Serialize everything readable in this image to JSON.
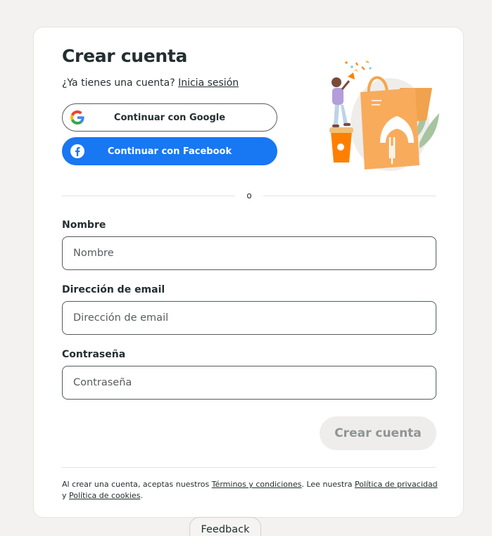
{
  "header": {
    "title": "Crear cuenta",
    "have_account": "¿Ya tienes una cuenta?",
    "login_link": "Inicia sesión"
  },
  "social": {
    "google_label": "Continuar con Google",
    "facebook_label": "Continuar con Facebook"
  },
  "divider": {
    "text": "o"
  },
  "form": {
    "name_label": "Nombre",
    "name_placeholder": "Nombre",
    "email_label": "Dirección de email",
    "email_placeholder": "Dirección de email",
    "password_label": "Contraseña",
    "password_placeholder": "Contraseña",
    "submit_label": "Crear cuenta"
  },
  "legal": {
    "part1": "Al crear una cuenta, aceptas nuestros ",
    "terms": "Términos y condiciones",
    "part2": ". Lee nuestra ",
    "privacy": "Política de privacidad",
    "part3": " y ",
    "cookies": "Política de cookies",
    "part4": "."
  },
  "feedback": {
    "label": "Feedback"
  },
  "colors": {
    "facebook_blue": "#1877f2",
    "brand_orange": "#ff8000",
    "text_dark": "#242e30",
    "disabled_bg": "#eeedeb",
    "disabled_text": "#8f9495"
  }
}
